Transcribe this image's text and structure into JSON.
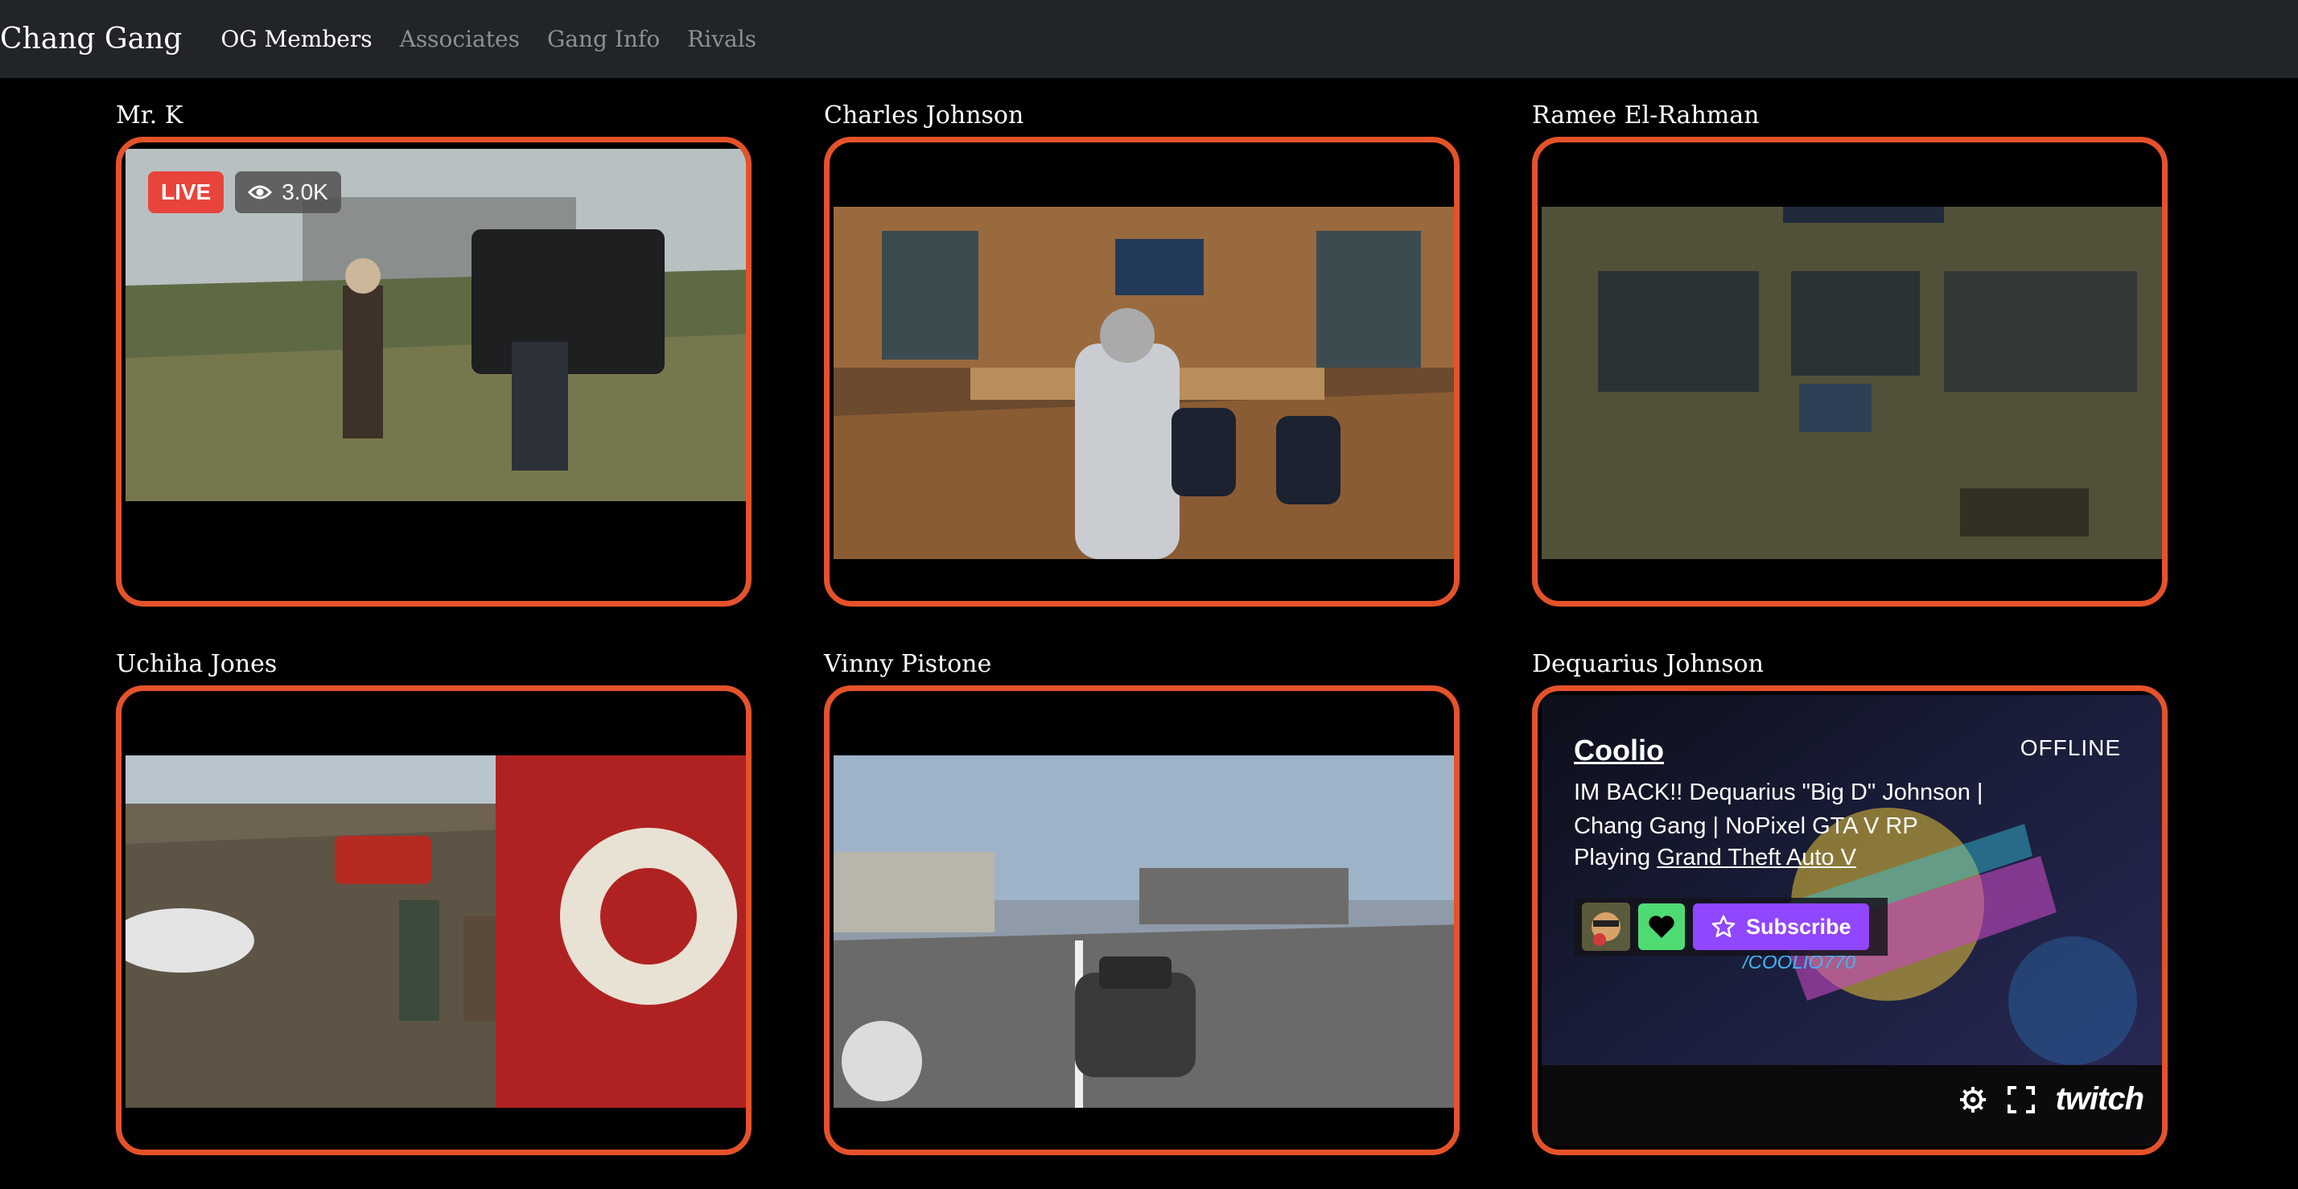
{
  "navbar": {
    "brand": "Chang Gang",
    "links": [
      {
        "label": "OG Members",
        "active": true
      },
      {
        "label": "Associates",
        "active": false
      },
      {
        "label": "Gang Info",
        "active": false
      },
      {
        "label": "Rivals",
        "active": false
      }
    ]
  },
  "accent_color": "#e5522a",
  "members": [
    {
      "name": "Mr. K",
      "status": "live",
      "live_label": "LIVE",
      "viewers": "3.0K",
      "viewer_icon": "eye-icon"
    },
    {
      "name": "Charles Johnson",
      "status": "video"
    },
    {
      "name": "Ramee El-Rahman",
      "status": "video"
    },
    {
      "name": "Uchiha Jones",
      "status": "video"
    },
    {
      "name": "Vinny Pistone",
      "status": "video"
    },
    {
      "name": "Dequarius Johnson",
      "status": "offline",
      "channel": "Coolio",
      "offline_label": "OFFLINE",
      "stream_title": "IM BACK!! Dequarius \"Big D\" Johnson | Chang Gang | NoPixel GTA V RP",
      "playing_prefix": "Playing",
      "game": "Grand Theft Auto V",
      "subscribe_label": "Subscribe",
      "social_handle": "/COOLIO770",
      "player_logo": "twitch",
      "player_icons": [
        "gear-icon",
        "fullscreen-icon"
      ]
    }
  ]
}
